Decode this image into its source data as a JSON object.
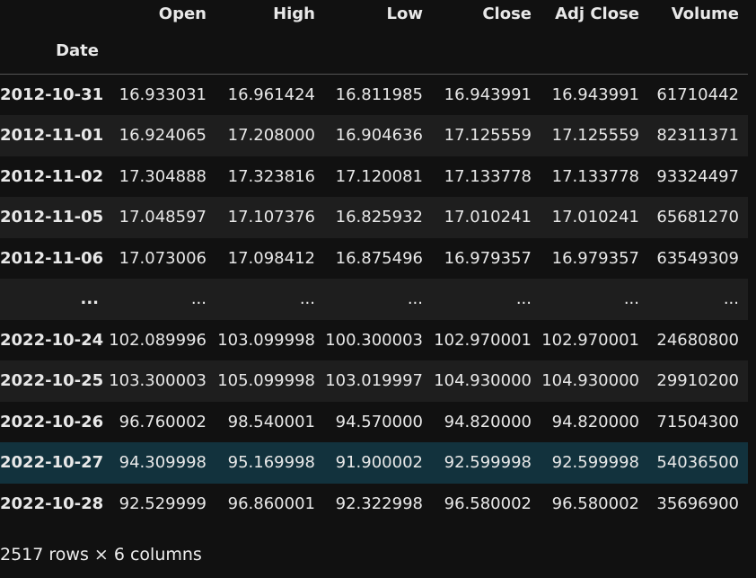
{
  "columns": [
    "Open",
    "High",
    "Low",
    "Close",
    "Adj Close",
    "Volume"
  ],
  "index_name": "Date",
  "rows": [
    {
      "date": "2012-10-31",
      "values": [
        "16.933031",
        "16.961424",
        "16.811985",
        "16.943991",
        "16.943991",
        "61710442"
      ]
    },
    {
      "date": "2012-11-01",
      "values": [
        "16.924065",
        "17.208000",
        "16.904636",
        "17.125559",
        "17.125559",
        "82311371"
      ]
    },
    {
      "date": "2012-11-02",
      "values": [
        "17.304888",
        "17.323816",
        "17.120081",
        "17.133778",
        "17.133778",
        "93324497"
      ]
    },
    {
      "date": "2012-11-05",
      "values": [
        "17.048597",
        "17.107376",
        "16.825932",
        "17.010241",
        "17.010241",
        "65681270"
      ]
    },
    {
      "date": "2012-11-06",
      "values": [
        "17.073006",
        "17.098412",
        "16.875496",
        "16.979357",
        "16.979357",
        "63549309"
      ]
    },
    {
      "date": "...",
      "values": [
        "...",
        "...",
        "...",
        "...",
        "...",
        "..."
      ]
    },
    {
      "date": "2022-10-24",
      "values": [
        "102.089996",
        "103.099998",
        "100.300003",
        "102.970001",
        "102.970001",
        "24680800"
      ]
    },
    {
      "date": "2022-10-25",
      "values": [
        "103.300003",
        "105.099998",
        "103.019997",
        "104.930000",
        "104.930000",
        "29910200"
      ]
    },
    {
      "date": "2022-10-26",
      "values": [
        "96.760002",
        "98.540001",
        "94.570000",
        "94.820000",
        "94.820000",
        "71504300"
      ]
    },
    {
      "date": "2022-10-27",
      "values": [
        "94.309998",
        "95.169998",
        "91.900002",
        "92.599998",
        "92.599998",
        "54036500"
      ]
    },
    {
      "date": "2022-10-28",
      "values": [
        "92.529999",
        "96.860001",
        "92.322998",
        "96.580002",
        "96.580002",
        "35696900"
      ]
    }
  ],
  "shape_text": "2517 rows × 6 columns",
  "colors": {
    "background": "#111111",
    "row_alt": "#1e1e1e",
    "row_selected": "#12323d",
    "text": "#e8e8e8"
  }
}
